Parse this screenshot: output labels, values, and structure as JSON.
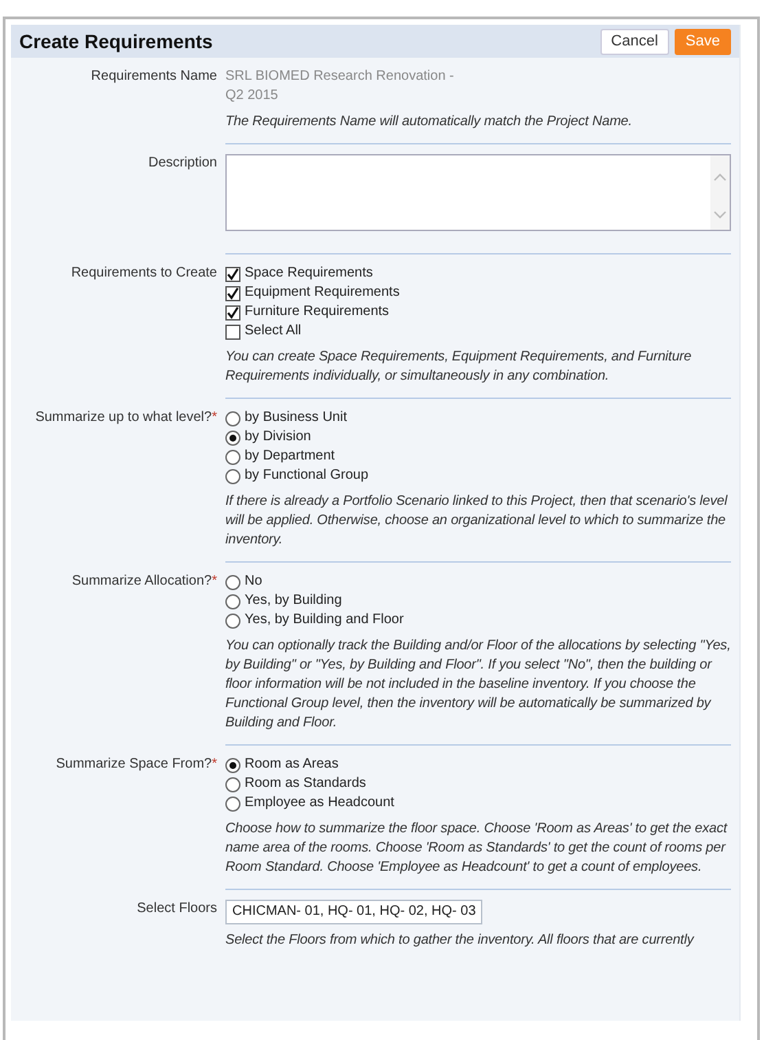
{
  "title": "Create Requirements",
  "buttons": [
    {
      "label": "Cancel",
      "kind": "secondary"
    },
    {
      "label": "Save",
      "kind": "primary"
    }
  ],
  "fields": [
    {
      "kind": "readonly",
      "label": "Requirements Name",
      "value": "SRL BIOMED Research Renovation - Q2 2015",
      "help": "The Requirements Name will automatically match the Project Name."
    },
    {
      "kind": "textarea",
      "label": "Description"
    },
    {
      "kind": "checkboxes",
      "label": "Requirements to Create",
      "options": [
        {
          "label": "Space Requirements",
          "checked": true
        },
        {
          "label": "Equipment Requirements",
          "checked": true
        },
        {
          "label": "Furniture Requirements",
          "checked": true
        },
        {
          "label": "Select All",
          "checked": false
        }
      ],
      "help": "You can create Space Requirements, Equipment Requirements, and Furniture Requirements individually, or simultaneously in any combination."
    },
    {
      "kind": "radios",
      "label": "Summarize up to what level?",
      "required_mark": "*",
      "options": [
        {
          "label": "by Business Unit",
          "selected": false
        },
        {
          "label": "by Division",
          "selected": true
        },
        {
          "label": "by Department",
          "selected": false
        },
        {
          "label": "by Functional Group",
          "selected": false
        }
      ],
      "help": "If there is already a Portfolio Scenario linked to this Project, then that scenario's level will be applied. Otherwise, choose an organizational level to which to summarize the inventory."
    },
    {
      "kind": "radios",
      "label": "Summarize Allocation?",
      "required_mark": "*",
      "options": [
        {
          "label": "No",
          "selected": false
        },
        {
          "label": "Yes, by Building",
          "selected": false
        },
        {
          "label": "Yes, by Building and Floor",
          "selected": false
        }
      ],
      "help": "You can optionally track the Building and/or Floor of the allocations by selecting \"Yes, by Building\" or \"Yes, by Building and Floor\". If you select \"No\", then the building or floor information will be not included in the baseline inventory. If you choose the Functional Group level, then the inventory will be automatically be summarized by Building and Floor."
    },
    {
      "kind": "radios",
      "label": "Summarize Space From?",
      "required_mark": "*",
      "options": [
        {
          "label": "Room as Areas",
          "selected": true
        },
        {
          "label": "Room as Standards",
          "selected": false
        },
        {
          "label": "Employee as Headcount",
          "selected": false
        }
      ],
      "help": "Choose how to summarize the floor space. Choose 'Room as Areas' to get the exact name area of the rooms. Choose 'Room as Standards' to get the count of rooms per Room Standard. Choose 'Employee as Headcount' to get a count of employees."
    },
    {
      "kind": "input",
      "label": "Select Floors",
      "value": "CHICMAN- 01, HQ- 01, HQ- 02, HQ- 03",
      "help": "Select the Floors from which to gather the inventory. All floors that are currently"
    }
  ]
}
